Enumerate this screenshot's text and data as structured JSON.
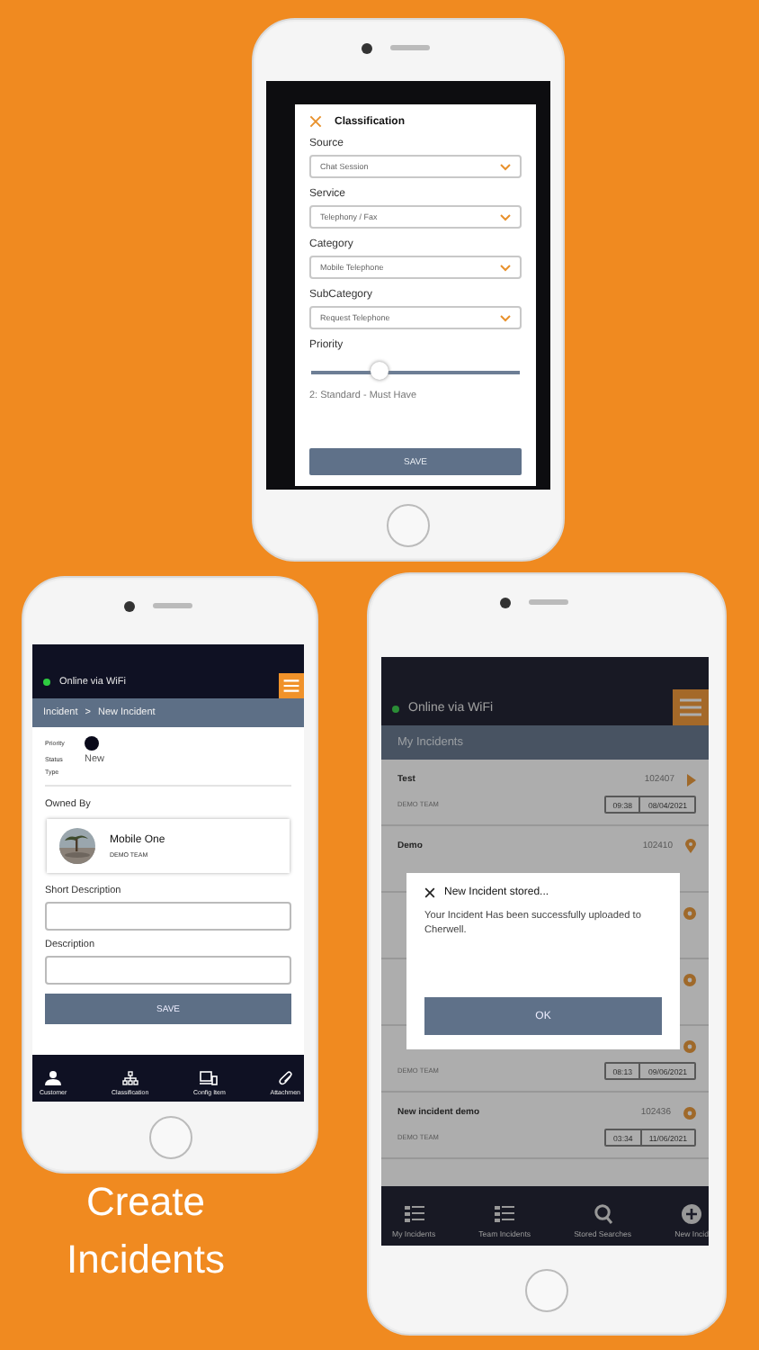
{
  "classification": {
    "title": "Classification",
    "fields": [
      {
        "label": "Source",
        "value": "Chat Session"
      },
      {
        "label": "Service",
        "value": "Telephony / Fax"
      },
      {
        "label": "Category",
        "value": "Mobile Telephone"
      },
      {
        "label": "SubCategory",
        "value": "Request Telephone"
      }
    ],
    "priority": {
      "label": "Priority",
      "level": 0.33,
      "reading": "2: Standard - Must Have"
    },
    "save": "SAVE"
  },
  "new_incident": {
    "status_text": "Online via WiFi",
    "online": true,
    "breadcrumb": [
      "Incident",
      "New Incident"
    ],
    "separator": ">",
    "meta_labels": [
      "Priority",
      "Status",
      "Type"
    ],
    "status_value": "New",
    "owned_by_label": "Owned By",
    "owner": {
      "name": "Mobile One",
      "team": "DEMO TEAM"
    },
    "fields": [
      {
        "label": "Short Description"
      },
      {
        "label": "Description"
      }
    ],
    "save": "SAVE",
    "tabs": [
      "Customer",
      "Classification",
      "Config Item",
      "Attachmen"
    ]
  },
  "incidents": {
    "status_text": "Online via WiFi",
    "online": true,
    "heading": "My Incidents",
    "rows": [
      {
        "kind": "arrow",
        "title": "Test",
        "id": "102407",
        "team": "DEMO TEAM",
        "time": "09:38",
        "date": "08/04/2021"
      },
      {
        "kind": "pin",
        "title": "Demo",
        "id": "102410"
      },
      {
        "kind": "dot"
      },
      {
        "kind": "dot"
      },
      {
        "kind": "dot",
        "team": "DEMO TEAM",
        "time": "08:13",
        "date": "09/06/2021"
      },
      {
        "kind": "dot",
        "title": "New incident demo",
        "id": "102436",
        "team": "DEMO TEAM",
        "time": "03:34",
        "date": "11/06/2021"
      }
    ],
    "dialog": {
      "title": "New Incident stored...",
      "message": "Your Incident Has been successfully uploaded to Cherwell.",
      "button": "OK"
    },
    "tabs": [
      "My Incidents",
      "Team Incidents",
      "Stored Searches",
      "New Incid"
    ]
  },
  "caption": "Create Incidents"
}
